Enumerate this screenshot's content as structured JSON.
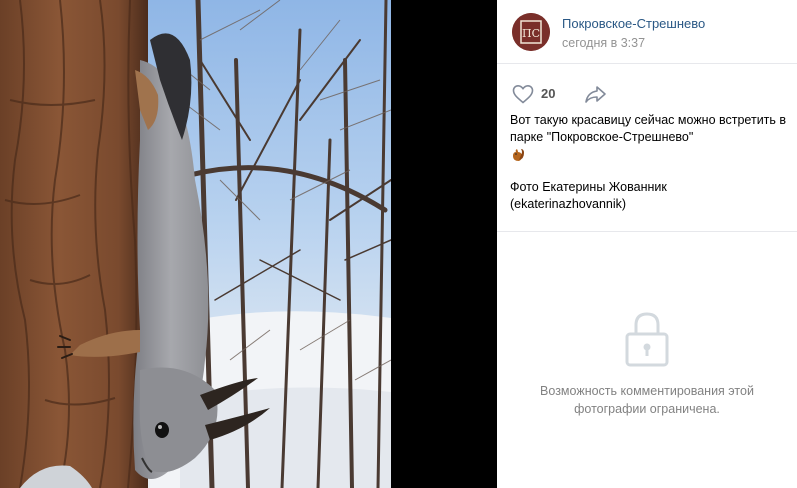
{
  "viewer": {
    "photo_alt": "squirrel-photo"
  },
  "author": {
    "name": "Покровское-Стрешнево",
    "date": "сегодня в 3:37",
    "avatar_text": "ПС"
  },
  "actions": {
    "like_count": "20",
    "like_icon": "heart-icon",
    "share_icon": "share-arrow-icon"
  },
  "post": {
    "text_line1": "Вот такую красавицу сейчас можно встретить в парке \"Покровское-Стрешнево\"",
    "credit_line1": "Фото Екатерины Жованник",
    "credit_line2": "(ekaterinazhovannik)"
  },
  "comments": {
    "closed_text": "Возможность комментирования этой фотографии ограничена.",
    "lock_icon": "lock-icon"
  },
  "colors": {
    "link": "#2a5885",
    "muted": "#939393",
    "divider": "#e7e8ec",
    "avatar_bg": "#7a2f2a"
  }
}
